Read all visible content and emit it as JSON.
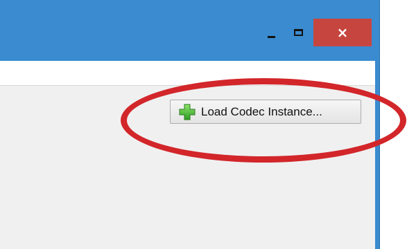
{
  "window": {
    "caption_buttons": {
      "minimize_icon": "minimize-icon",
      "maximize_icon": "maximize-icon",
      "close_symbol": "×"
    }
  },
  "toolbar": {
    "load_codec_label": "Load Codec Instance...",
    "load_codec_icon": "green-plus-icon"
  },
  "colors": {
    "frame": "#3a8bd0",
    "close_button": "#c7453f",
    "highlight": "#d2262a",
    "client_background": "#f0f0f0"
  }
}
